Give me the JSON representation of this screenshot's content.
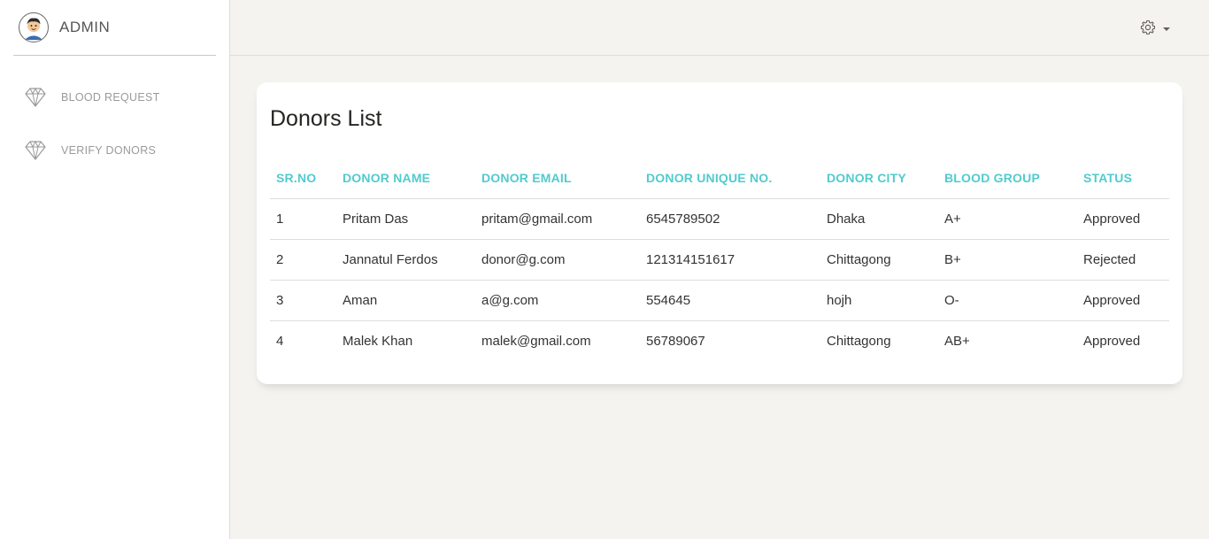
{
  "brand": {
    "name": "ADMIN",
    "avatar_icon": "user-avatar-icon"
  },
  "sidebar": {
    "items": [
      {
        "label": "BLOOD REQUEST",
        "icon": "diamond-icon"
      },
      {
        "label": "VERIFY DONORS",
        "icon": "diamond-icon"
      }
    ]
  },
  "topbar": {
    "settings_icon": "gear-icon",
    "dropdown_icon": "caret-down-icon"
  },
  "card": {
    "title": "Donors List"
  },
  "table": {
    "headers": [
      "SR.NO",
      "DONOR NAME",
      "DONOR EMAIL",
      "DONOR UNIQUE NO.",
      "DONOR CITY",
      "BLOOD GROUP",
      "STATUS"
    ],
    "rows": [
      [
        "1",
        "Pritam Das",
        "pritam@gmail.com",
        "6545789502",
        "Dhaka",
        "A+",
        "Approved"
      ],
      [
        "2",
        "Jannatul Ferdos",
        "donor@g.com",
        "121314151617",
        "Chittagong",
        "B+",
        "Rejected"
      ],
      [
        "3",
        "Aman",
        "a@g.com",
        "554645",
        "hojh",
        "O-",
        "Approved"
      ],
      [
        "4",
        "Malek Khan",
        "malek@gmail.com",
        "56789067",
        "Chittagong",
        "AB+",
        "Approved"
      ]
    ]
  },
  "colors": {
    "accent": "#51cbce",
    "background": "#f4f3ef",
    "card": "#ffffff"
  }
}
